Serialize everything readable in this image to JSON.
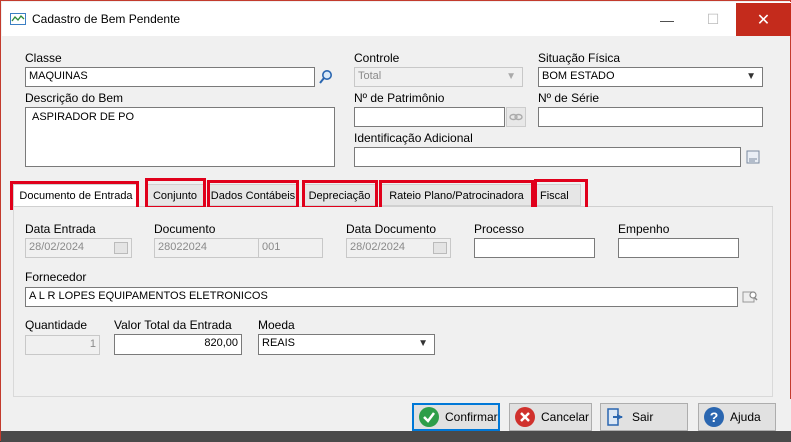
{
  "window": {
    "title": "Cadastro de Bem Pendente",
    "minimize": "—",
    "maximize": "☐",
    "close": "✕"
  },
  "top": {
    "classe_label": "Classe",
    "classe_value": "MAQUINAS",
    "controle_label": "Controle",
    "controle_value": "Total",
    "situacao_label": "Situação Física",
    "situacao_value": "BOM ESTADO",
    "descricao_label": "Descrição do Bem",
    "descricao_value": "ASPIRADOR DE PO",
    "patrimonio_label": "Nº de Patrimônio",
    "patrimonio_value": "",
    "serie_label": "Nº de Série",
    "serie_value": "",
    "identificacao_label": "Identificação Adicional",
    "identificacao_value": ""
  },
  "tabs": [
    {
      "label": "Documento de Entrada"
    },
    {
      "label": "Conjunto"
    },
    {
      "label": "Dados Contábeis"
    },
    {
      "label": "Depreciação"
    },
    {
      "label": "Rateio Plano/Patrocinadora"
    },
    {
      "label": "Fiscal"
    }
  ],
  "entrada": {
    "data_entrada_label": "Data Entrada",
    "data_entrada_value": "28/02/2024",
    "documento_label": "Documento",
    "documento_value": "28022024",
    "documento_serie": "001",
    "data_documento_label": "Data Documento",
    "data_documento_value": "28/02/2024",
    "processo_label": "Processo",
    "processo_value": "",
    "empenho_label": "Empenho",
    "empenho_value": "",
    "fornecedor_label": "Fornecedor",
    "fornecedor_value": "A L R LOPES EQUIPAMENTOS ELETRONICOS",
    "quantidade_label": "Quantidade",
    "quantidade_value": "1",
    "valor_label": "Valor Total da Entrada",
    "valor_value": "820,00",
    "moeda_label": "Moeda",
    "moeda_value": "REAIS"
  },
  "footer": {
    "confirmar": "Confirmar",
    "cancelar": "Cancelar",
    "sair": "Sair",
    "ajuda": "Ajuda"
  },
  "colors": {
    "highlight": "#e0001b",
    "close_btn": "#c42b1c",
    "primary_border": "#0078d7"
  }
}
